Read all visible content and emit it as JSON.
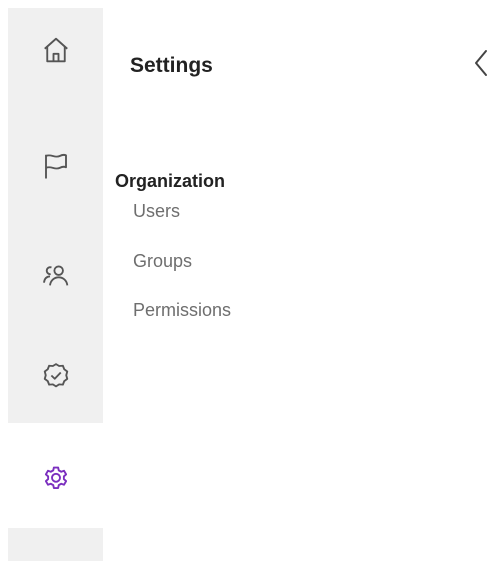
{
  "app": {
    "accent_color": "#7b2fbf",
    "icon_color": "#555555",
    "rail_bg_color": "#f0f0f0"
  },
  "rail": {
    "items": [
      {
        "icon": "home-icon",
        "active": false
      },
      {
        "icon": "flag-icon",
        "active": false
      },
      {
        "icon": "people-icon",
        "active": false
      },
      {
        "icon": "check-circle-icon",
        "active": false
      },
      {
        "icon": "gear-icon",
        "active": true
      }
    ]
  },
  "panel": {
    "title": "Settings",
    "collapse_icon": "chevron-left-icon",
    "section": {
      "title": "Organization",
      "links": [
        "Users",
        "Groups",
        "Permissions"
      ]
    }
  }
}
